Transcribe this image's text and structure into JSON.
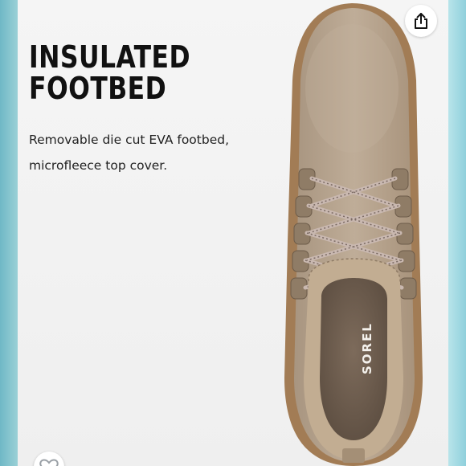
{
  "feature": {
    "title_line1": "INSULATED",
    "title_line2": "FOOTBED",
    "description": "Removable die cut EVA footbed, microfleece top cover."
  },
  "product": {
    "brand_mark": "SOREL"
  },
  "icons": {
    "share": "share-icon",
    "like": "heart-icon"
  },
  "colors": {
    "suede": "#b7a48f",
    "lining": "#c2ad92",
    "sole": "#a27c55",
    "accent_left": "#6fb8c6",
    "accent_right": "#9ad8e0"
  }
}
